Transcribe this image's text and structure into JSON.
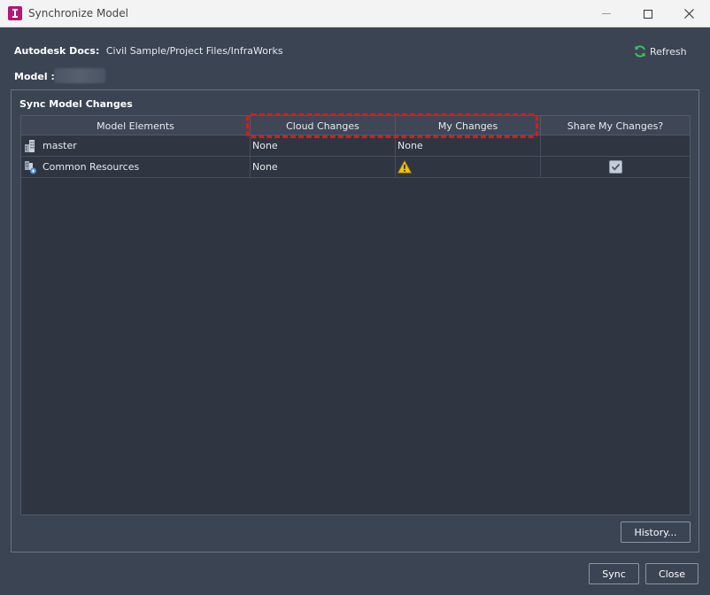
{
  "window": {
    "title": "Synchronize Model"
  },
  "header": {
    "docs_label": "Autodesk Docs:",
    "docs_path": "Civil Sample/Project Files/InfraWorks",
    "model_label": "Model :",
    "refresh_label": "Refresh"
  },
  "group": {
    "title": "Sync Model Changes",
    "columns": [
      "Model Elements",
      "Cloud Changes",
      "My Changes",
      "Share My Changes?"
    ],
    "rows": [
      {
        "name": "master",
        "icon": "building-icon",
        "cloud_changes": "None",
        "my_changes": "None",
        "share": null
      },
      {
        "name": "Common Resources",
        "icon": "shared-resources-icon",
        "cloud_changes": "None",
        "my_changes_icon": "warning-icon",
        "share": true
      }
    ]
  },
  "buttons": {
    "history": "History...",
    "sync": "Sync",
    "close": "Close"
  },
  "colors": {
    "background": "#3b4453",
    "grid_bg": "#2f3642",
    "highlight": "#e01818",
    "warning": "#f2c200",
    "refresh_icon": "#3cc060"
  }
}
